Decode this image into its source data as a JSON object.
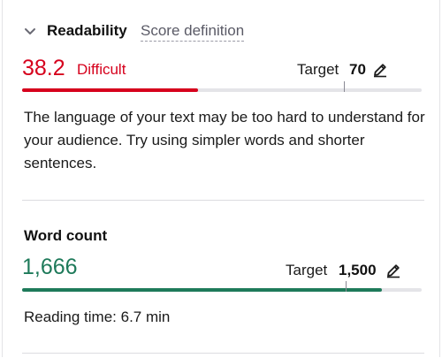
{
  "readability": {
    "title": "Readability",
    "score_definition_link": "Score definition",
    "score": "38.2",
    "score_label": "Difficult",
    "target_label": "Target",
    "target_value": "70",
    "progress_fraction": 0.382,
    "target_fraction": 0.7,
    "description": "The language of your text may be too hard to understand for your audience. Try using simpler words and shorter sentences.",
    "accent_color": "#d6001c"
  },
  "word_count": {
    "title": "Word count",
    "count": "1,666",
    "target_label": "Target",
    "target_value": "1,500",
    "progress_fraction": 0.9,
    "target_fraction": 0.81,
    "reading_time": "Reading time: 6.7 min",
    "accent_color": "#1e7a5a"
  },
  "icons": {
    "collapse": "chevron-down-icon",
    "edit": "pencil-icon"
  }
}
